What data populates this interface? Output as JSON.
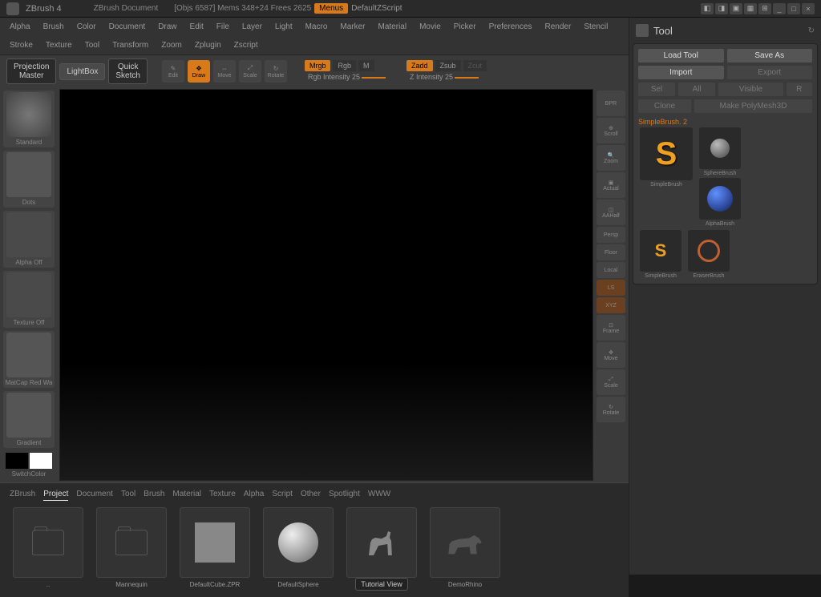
{
  "titlebar": {
    "app": "ZBrush 4",
    "doc": "ZBrush Document",
    "stats": "[Objs 6587]  Mems 348+24  Frees 2625",
    "menus": "Menus",
    "script": "DefaultZScript"
  },
  "menu": [
    "Alpha",
    "Brush",
    "Color",
    "Document",
    "Draw",
    "Edit",
    "File",
    "Layer",
    "Light",
    "Macro",
    "Marker",
    "Material",
    "Movie",
    "Picker",
    "Preferences",
    "Render",
    "Stencil",
    "Stroke",
    "Texture",
    "Tool",
    "Transform",
    "Zoom",
    "Zplugin",
    "Zscript"
  ],
  "toolbar": {
    "projection": "Projection\nMaster",
    "lightbox": "LightBox",
    "quicksketch": "Quick\nSketch",
    "edit": "Edit",
    "draw": "Draw",
    "move": "Move",
    "scale": "Scale",
    "rotate": "Rotate",
    "mrgb": "Mrgb",
    "rgb": "Rgb",
    "m": "M",
    "zadd": "Zadd",
    "zsub": "Zsub",
    "zcut": "Zcut",
    "rgb_int": "Rgb Intensity 25",
    "z_int": "Z Intensity 25"
  },
  "left_tray": {
    "brush": "Standard",
    "stroke": "Dots",
    "alpha": "Alpha Off",
    "texture": "Texture Off",
    "material": "MatCap Red Wa",
    "gradient": "Gradient",
    "switch": "SwitchColor"
  },
  "right_tray": [
    "BPR",
    "Scroll",
    "Zoom",
    "Actual",
    "AAHalf",
    "Persp",
    "Floor",
    "Local",
    "LS",
    "XYZ",
    "Frame",
    "Move",
    "Scale",
    "Rotate"
  ],
  "lightbox": {
    "tabs": [
      "ZBrush",
      "Project",
      "Document",
      "Tool",
      "Brush",
      "Material",
      "Texture",
      "Alpha",
      "Script",
      "Other",
      "Spotlight",
      "WWW"
    ],
    "active_tab": "Project",
    "items": [
      {
        "label": " "
      },
      {
        "label": "Mannequin"
      },
      {
        "label": "DefaultCube.ZPR"
      },
      {
        "label": "DefaultSphere"
      },
      {
        "label": " "
      },
      {
        "label": "DemoRhino"
      }
    ],
    "tutorial": "Tutorial View"
  },
  "tool_panel": {
    "title": "Tool",
    "load": "Load Tool",
    "saveas": "Save As",
    "import": "Import",
    "export": "Export",
    "sel": "Sel",
    "all": "All",
    "visible": "Visible",
    "r": "R",
    "clone": "Clone",
    "polymesh": "Make PolyMesh3D",
    "active": "SimpleBrush. 2",
    "tools": [
      {
        "label": "SimpleBrush",
        "kind": "s-big"
      },
      {
        "label": "SphereBrush",
        "kind": "sphere-sm"
      },
      {
        "label": "AlphaBrush",
        "kind": "blue"
      },
      {
        "label": "SimpleBrush",
        "kind": "s-sm"
      },
      {
        "label": "EraserBrush",
        "kind": "erase"
      }
    ]
  }
}
